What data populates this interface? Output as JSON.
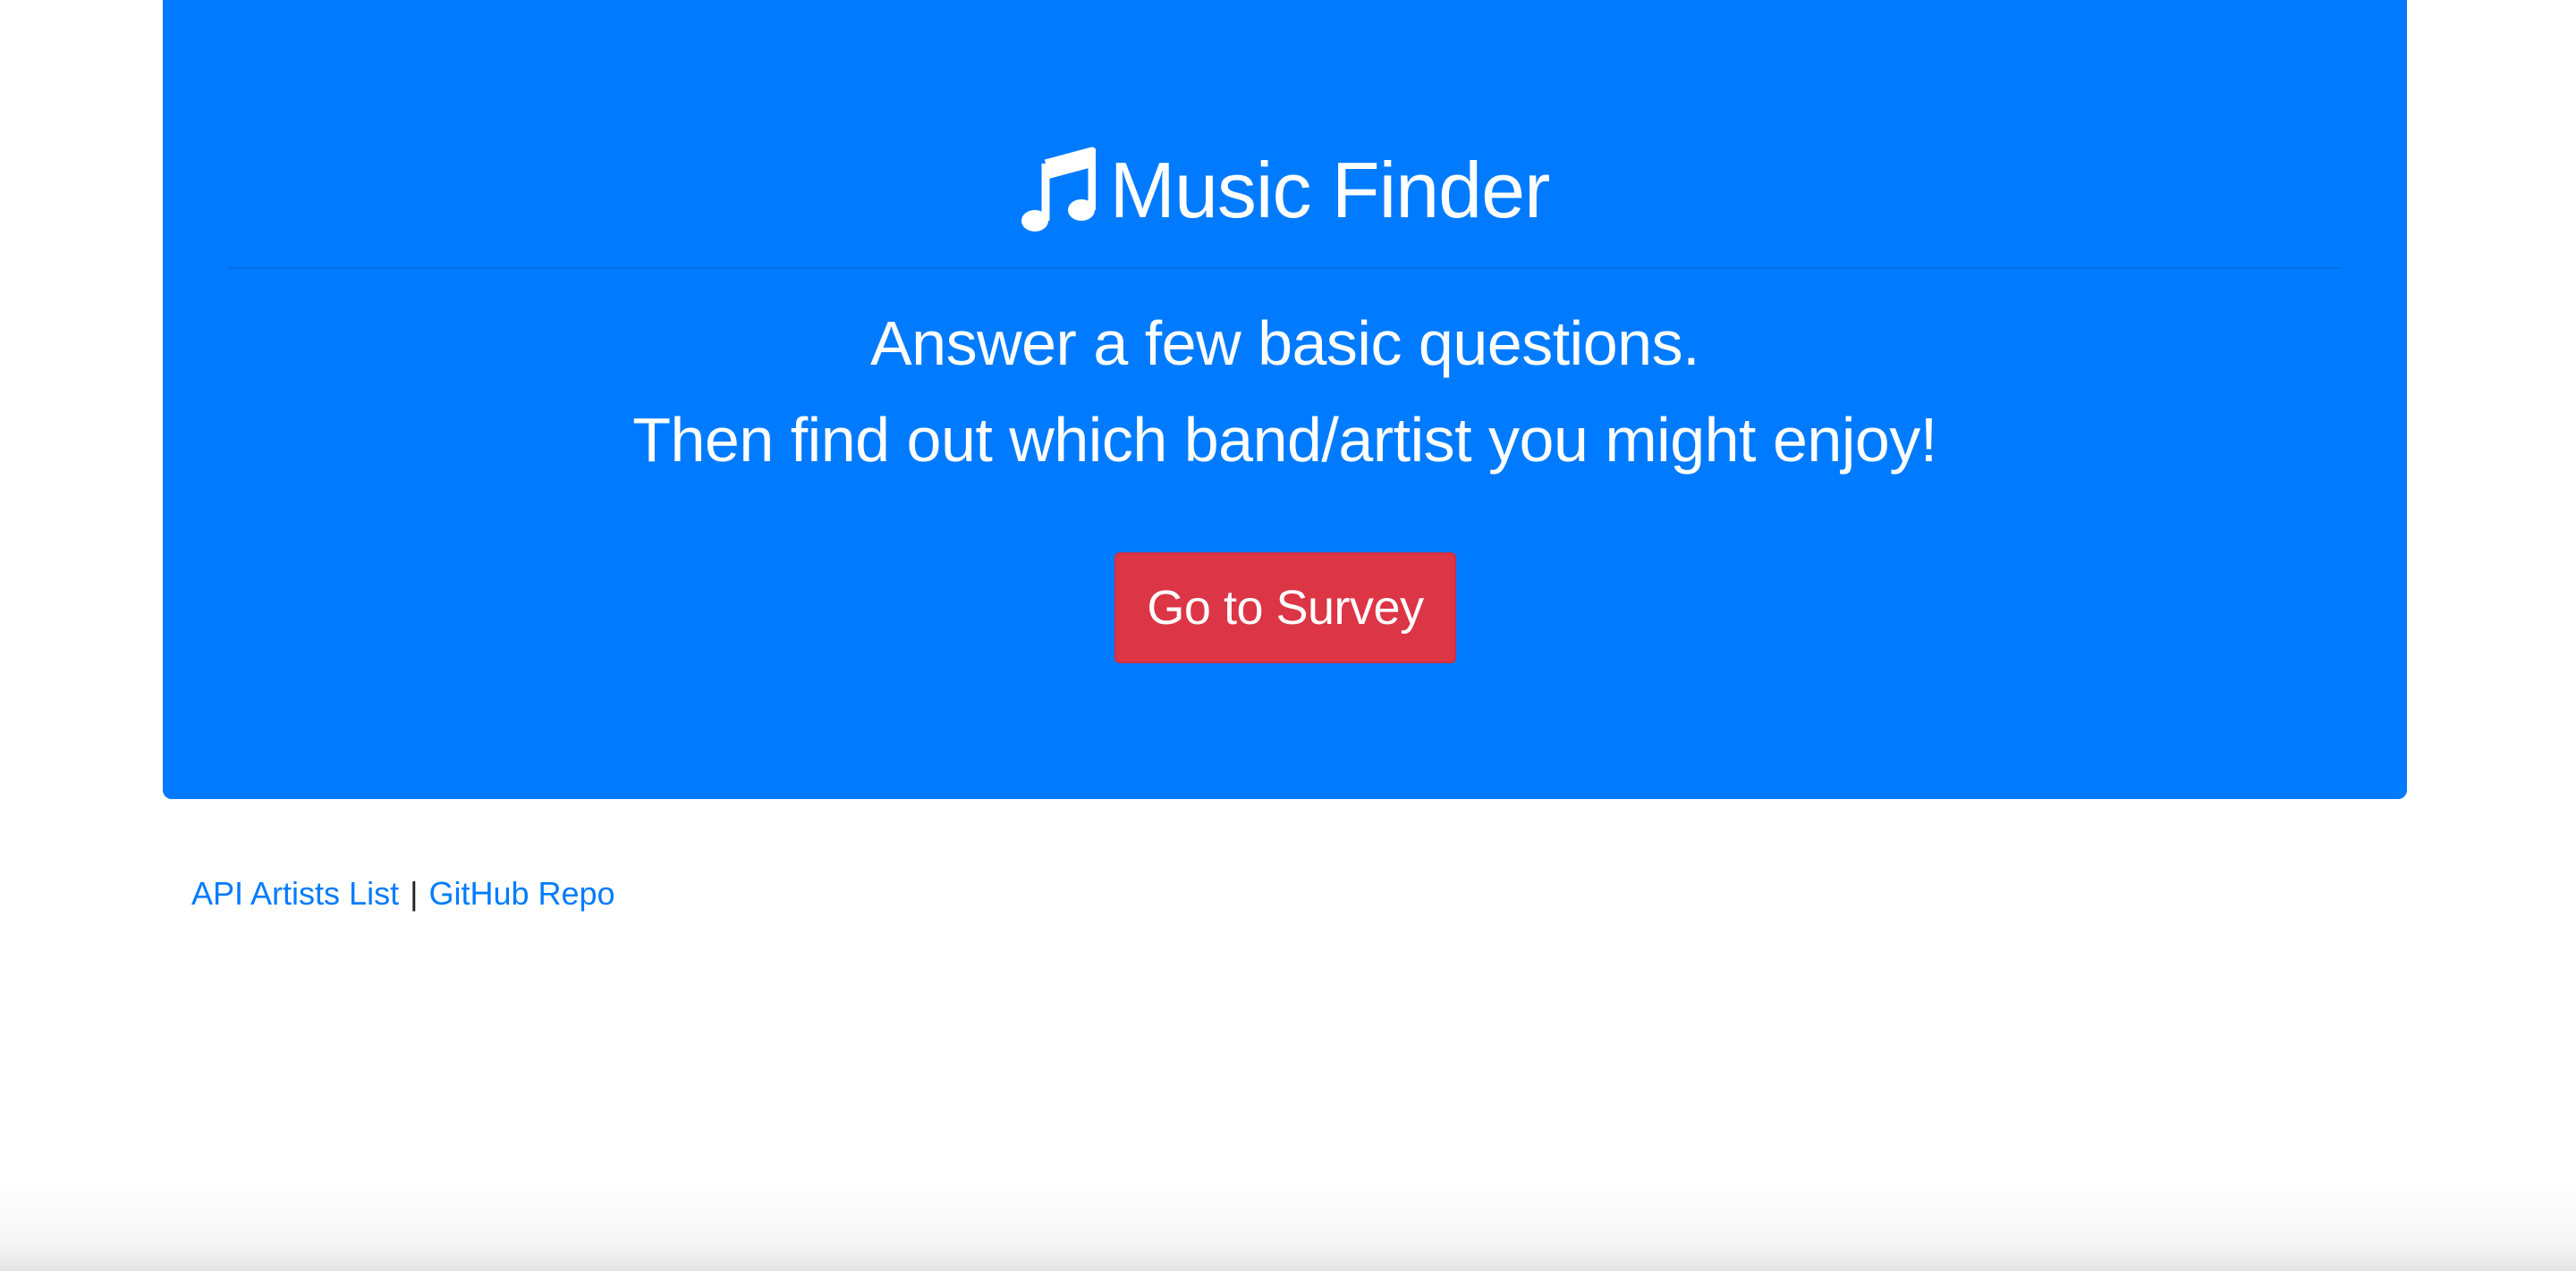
{
  "header": {
    "icon": "music-note-icon",
    "title": "Music Finder"
  },
  "lead": {
    "line1": "Answer a few basic questions.",
    "line2": "Then find out which band/artist you might enjoy!"
  },
  "cta": {
    "label": "Go to Survey"
  },
  "footer": {
    "link_api": "API Artists List",
    "separator": "|",
    "link_github": "GitHub Repo"
  },
  "colors": {
    "jumbotron": "#007bff",
    "button": "#dc3545",
    "link": "#007bff",
    "text_on_blue": "#ffffff"
  }
}
